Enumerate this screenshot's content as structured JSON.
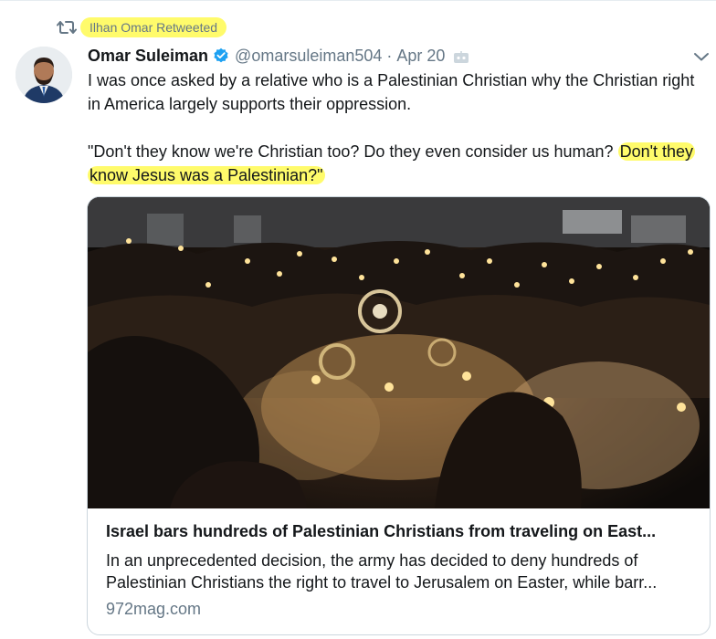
{
  "retweet_context": {
    "text": "Ilhan Omar Retweeted",
    "icon": "retweet-icon"
  },
  "author": {
    "name": "Omar Suleiman",
    "handle": "@omarsuleiman504",
    "separator": "·",
    "date": "Apr 20",
    "verified": true,
    "avatar_icon": "avatar-photo"
  },
  "tweet": {
    "line1": "I was once asked by a relative who is a Palestinian Christian why the Christian right in America largely supports their oppression.",
    "line2_plain": "\"Don't they know we're Christian too? Do they even consider us human? ",
    "line2_highlight": "Don't they know Jesus was a Palestinian?\""
  },
  "card": {
    "title": "Israel bars hundreds of Palestinian Christians from traveling on East...",
    "description_line1": "In an unprecedented decision, the army has decided to deny hundreds of",
    "description_line2": "Palestinian Christians the right to travel to Jerusalem on Easter, while barr...",
    "domain": "972mag.com"
  },
  "colors": {
    "highlight": "#fffb6b",
    "muted": "#657786",
    "verified_blue": "#1da1f2",
    "text": "#14171a"
  }
}
